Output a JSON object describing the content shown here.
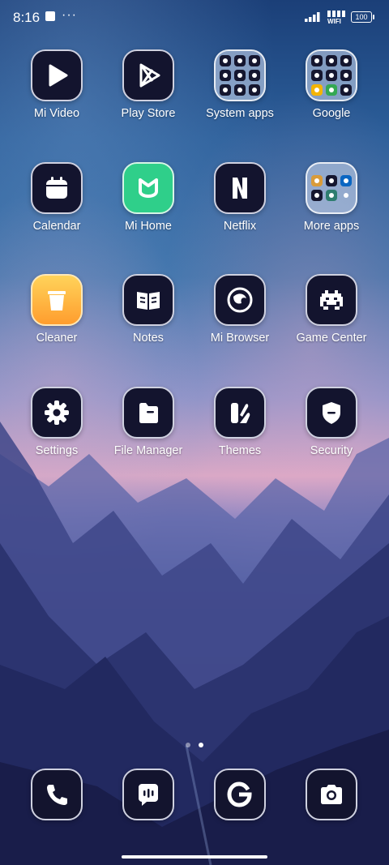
{
  "status_bar": {
    "time": "8:16",
    "more_indicator": "···",
    "network_label": "WIFI",
    "battery_level": "100"
  },
  "apps": [
    {
      "id": "mi-video",
      "label": "Mi Video",
      "icon": "play-icon"
    },
    {
      "id": "play-store",
      "label": "Play Store",
      "icon": "play-store-icon"
    },
    {
      "id": "system-apps",
      "label": "System apps",
      "icon": "folder-icon"
    },
    {
      "id": "google",
      "label": "Google",
      "icon": "folder-icon"
    },
    {
      "id": "calendar",
      "label": "Calendar",
      "icon": "calendar-icon"
    },
    {
      "id": "mi-home",
      "label": "Mi Home",
      "icon": "mi-home-icon"
    },
    {
      "id": "netflix",
      "label": "Netflix",
      "icon": "netflix-icon"
    },
    {
      "id": "more-apps",
      "label": "More apps",
      "icon": "folder-icon"
    },
    {
      "id": "cleaner",
      "label": "Cleaner",
      "icon": "trash-icon"
    },
    {
      "id": "notes",
      "label": "Notes",
      "icon": "book-icon"
    },
    {
      "id": "mi-browser",
      "label": "Mi Browser",
      "icon": "globe-icon"
    },
    {
      "id": "game-center",
      "label": "Game Center",
      "icon": "invader-icon"
    },
    {
      "id": "settings",
      "label": "Settings",
      "icon": "gear-icon"
    },
    {
      "id": "file-manager",
      "label": "File Manager",
      "icon": "file-icon"
    },
    {
      "id": "themes",
      "label": "Themes",
      "icon": "themes-icon"
    },
    {
      "id": "security",
      "label": "Security",
      "icon": "shield-icon"
    }
  ],
  "dock": [
    {
      "id": "phone",
      "icon": "phone-icon"
    },
    {
      "id": "messages",
      "icon": "message-icon"
    },
    {
      "id": "google-search",
      "icon": "google-g-icon"
    },
    {
      "id": "camera",
      "icon": "camera-icon"
    }
  ],
  "page_indicator": {
    "count": 2,
    "active": 2
  },
  "colors": {
    "icon_bg": "#13142e",
    "icon_border": "#cfd1e0",
    "mi_home_green": "#2fcf8a",
    "cleaner_orange": "#ffb13a"
  }
}
